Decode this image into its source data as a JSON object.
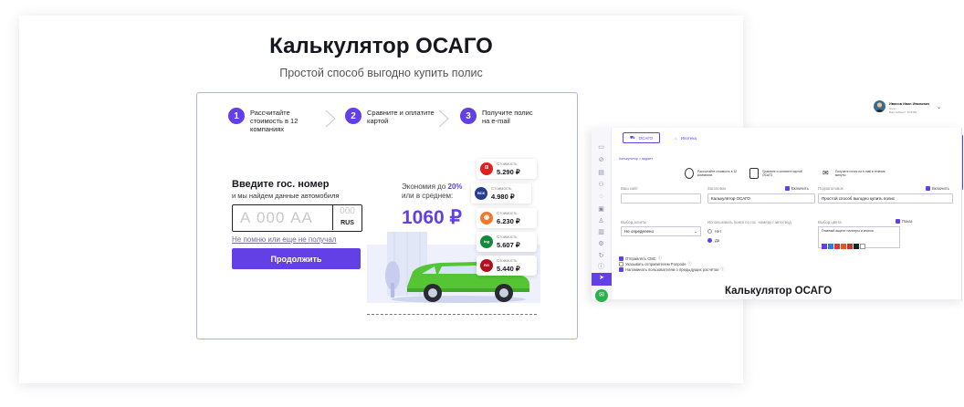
{
  "main": {
    "title": "Калькулятор ОСАГО",
    "subtitle": "Простой способ выгодно купить полис"
  },
  "steps": [
    {
      "num": "1",
      "text": "Рассчитайте стоимость в 12 компаниях"
    },
    {
      "num": "2",
      "text": "Сравните и оплатите картой"
    },
    {
      "num": "3",
      "text": "Получите полис на e-mail"
    }
  ],
  "plate": {
    "title": "Введите гос. номер",
    "subtitle": "и мы найдем данные автомобиля",
    "number_placeholder": "А 000 АА",
    "region_placeholder": "000",
    "country": "RUS",
    "forgot_link": "Не помню или еще не получал",
    "continue_button": "Продолжить"
  },
  "economy": {
    "line1_prefix": "Экономия до ",
    "line1_pct": "20%",
    "line2": "или в среднем:",
    "amount": "1060 ₽"
  },
  "insurers": [
    {
      "logo": "alfa-logo-icon",
      "char": "α",
      "color": "#e02020",
      "label": "Стоимость",
      "price": "5.290 ₽"
    },
    {
      "logo": "vsk-logo-icon",
      "char": "ВСК",
      "color": "#253d8c",
      "label": "Стоимость",
      "price": "4.980 ₽"
    },
    {
      "logo": "renins-logo-icon",
      "char": "◉",
      "color": "#f07828",
      "label": "Стоимость",
      "price": "6.230 ₽"
    },
    {
      "logo": "ingos-logo-icon",
      "char": "Ing",
      "color": "#128a3c",
      "label": "Стоимость",
      "price": "5.607 ₽"
    },
    {
      "logo": "rgs-logo-icon",
      "char": "RG",
      "color": "#b01020",
      "label": "Стоимость",
      "price": "5.440 ₽"
    }
  ],
  "admin": {
    "user_name": "Иванов Иван Иванович",
    "user_role": "Агент",
    "user_id": "Ваш кабинет: ID 8436",
    "tabs": [
      "ОСАГО",
      "Ипотека"
    ],
    "breadcrumb": "Калькулятор > виджет",
    "steps": [
      "Рассчитайте стоимость в 12 компаниях",
      "Сравните и оплатите картой ОСАГО",
      "Получите полис на e-mail в течение минуты"
    ],
    "field_site_label": "Ваш сайт",
    "field_site_value": "",
    "field_title_label": "Заголовок",
    "field_title_value": "Калькулятор ОСАГО",
    "field_title_toggle": "Включить",
    "field_sub_label": "Подзаголовок",
    "field_sub_value": "Простой способ выгодно купить полис",
    "field_sub_toggle": "Включить",
    "field_agency_label": "Выбор агенты",
    "field_agency_value": "Не определено",
    "radio_label": "Использовать поиск по гос. номеру / автосвод",
    "radio_no": "Нет",
    "radio_yes": "Да",
    "color_label": "Выбор цвета",
    "color_toggle": "Показ",
    "color_hint": "Главный акцент палитры и кнопок",
    "swatches": [
      "#6240e6",
      "#2a7de1",
      "#d33b3b",
      "#e05a1a",
      "#c0392b",
      "#222222"
    ],
    "check_sms": "Отправлять СМС",
    "check_regions": "Указывать отправителем Ponpode",
    "check_remind": "Напоминать пользователям о предыдущих расчётах"
  },
  "caption": "Калькулятор ОСАГО"
}
